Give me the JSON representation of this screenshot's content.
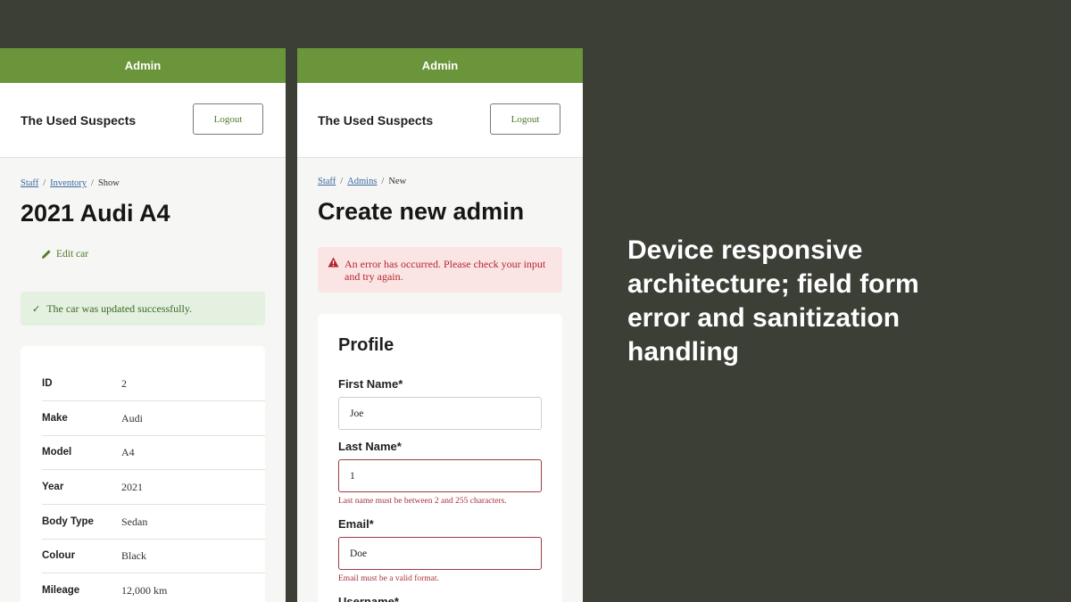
{
  "left_screen": {
    "topbar_title": "Admin",
    "brand": "The Used Suspects",
    "logout_label": "Logout",
    "breadcrumb": {
      "item1": "Staff",
      "item2": "Inventory",
      "current": "Show",
      "separator": "/"
    },
    "title": "2021 Audi A4",
    "edit_label": "Edit car",
    "success_message": "The car was updated successfully.",
    "details": [
      {
        "label": "ID",
        "value": "2"
      },
      {
        "label": "Make",
        "value": "Audi"
      },
      {
        "label": "Model",
        "value": "A4"
      },
      {
        "label": "Year",
        "value": "2021"
      },
      {
        "label": "Body Type",
        "value": "Sedan"
      },
      {
        "label": "Colour",
        "value": "Black"
      },
      {
        "label": "Mileage",
        "value": "12,000 km"
      }
    ]
  },
  "right_screen": {
    "topbar_title": "Admin",
    "brand": "The Used Suspects",
    "logout_label": "Logout",
    "breadcrumb": {
      "item1": "Staff",
      "item2": "Admins",
      "current": "New",
      "separator": "/"
    },
    "title": "Create new admin",
    "error_message": "An error has occurred. Please check your input and try again.",
    "form": {
      "section_title": "Profile",
      "first_name": {
        "label": "First Name*",
        "value": "Joe"
      },
      "last_name": {
        "label": "Last Name*",
        "value": "1",
        "error": "Last name must be between 2 and 255 characters."
      },
      "email": {
        "label": "Email*",
        "value": "Doe",
        "error": "Email must be a valid format."
      },
      "username": {
        "label": "Username*"
      }
    }
  },
  "tagline": "Device responsive architecture; field form error and sanitization handling",
  "colors": {
    "background": "#3c3f36",
    "topbar": "#6a953b",
    "success_bg": "#e4f0e0",
    "error_bg": "#fbe5e4",
    "error_text": "#b3262d"
  }
}
